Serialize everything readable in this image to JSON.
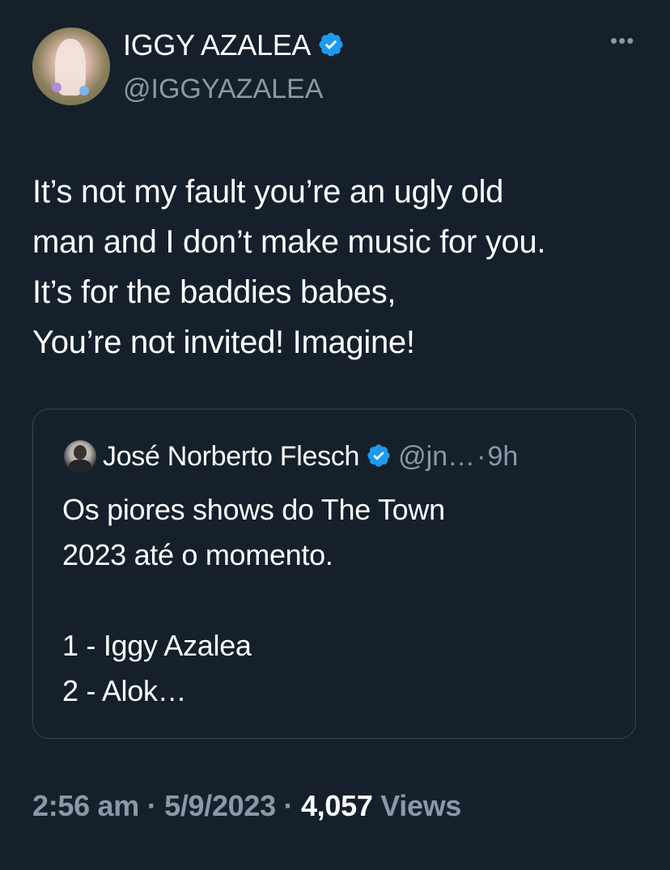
{
  "author": {
    "display_name": "IGGY AZALEA",
    "handle": "@IGGYAZALEA",
    "verified": true
  },
  "tweet": {
    "lines": [
      "It’s not my fault you’re an ugly old",
      "man and I don’t make music for you.",
      "It’s for the baddies babes,",
      "You’re not invited! Imagine!"
    ]
  },
  "quoted_tweet": {
    "display_name": "José Norberto Flesch",
    "handle": "@jn…",
    "separator": "·",
    "time": "9h",
    "verified": true,
    "lines": [
      "Os piores shows do The Town",
      "2023 até o momento.",
      "",
      "1 - Iggy Azalea",
      "2 - Alok…"
    ]
  },
  "meta": {
    "time": "2:56 am",
    "separator": "·",
    "date": "5/9/2023",
    "views_count": "4,057",
    "views_label": "Views"
  },
  "colors": {
    "background": "#15202b",
    "verified_blue": "#1d9bf0",
    "secondary_text": "#8b98a5",
    "border": "#38444d"
  },
  "icons": {
    "more": "more-horizontal-icon",
    "verified": "verified-badge-icon"
  }
}
